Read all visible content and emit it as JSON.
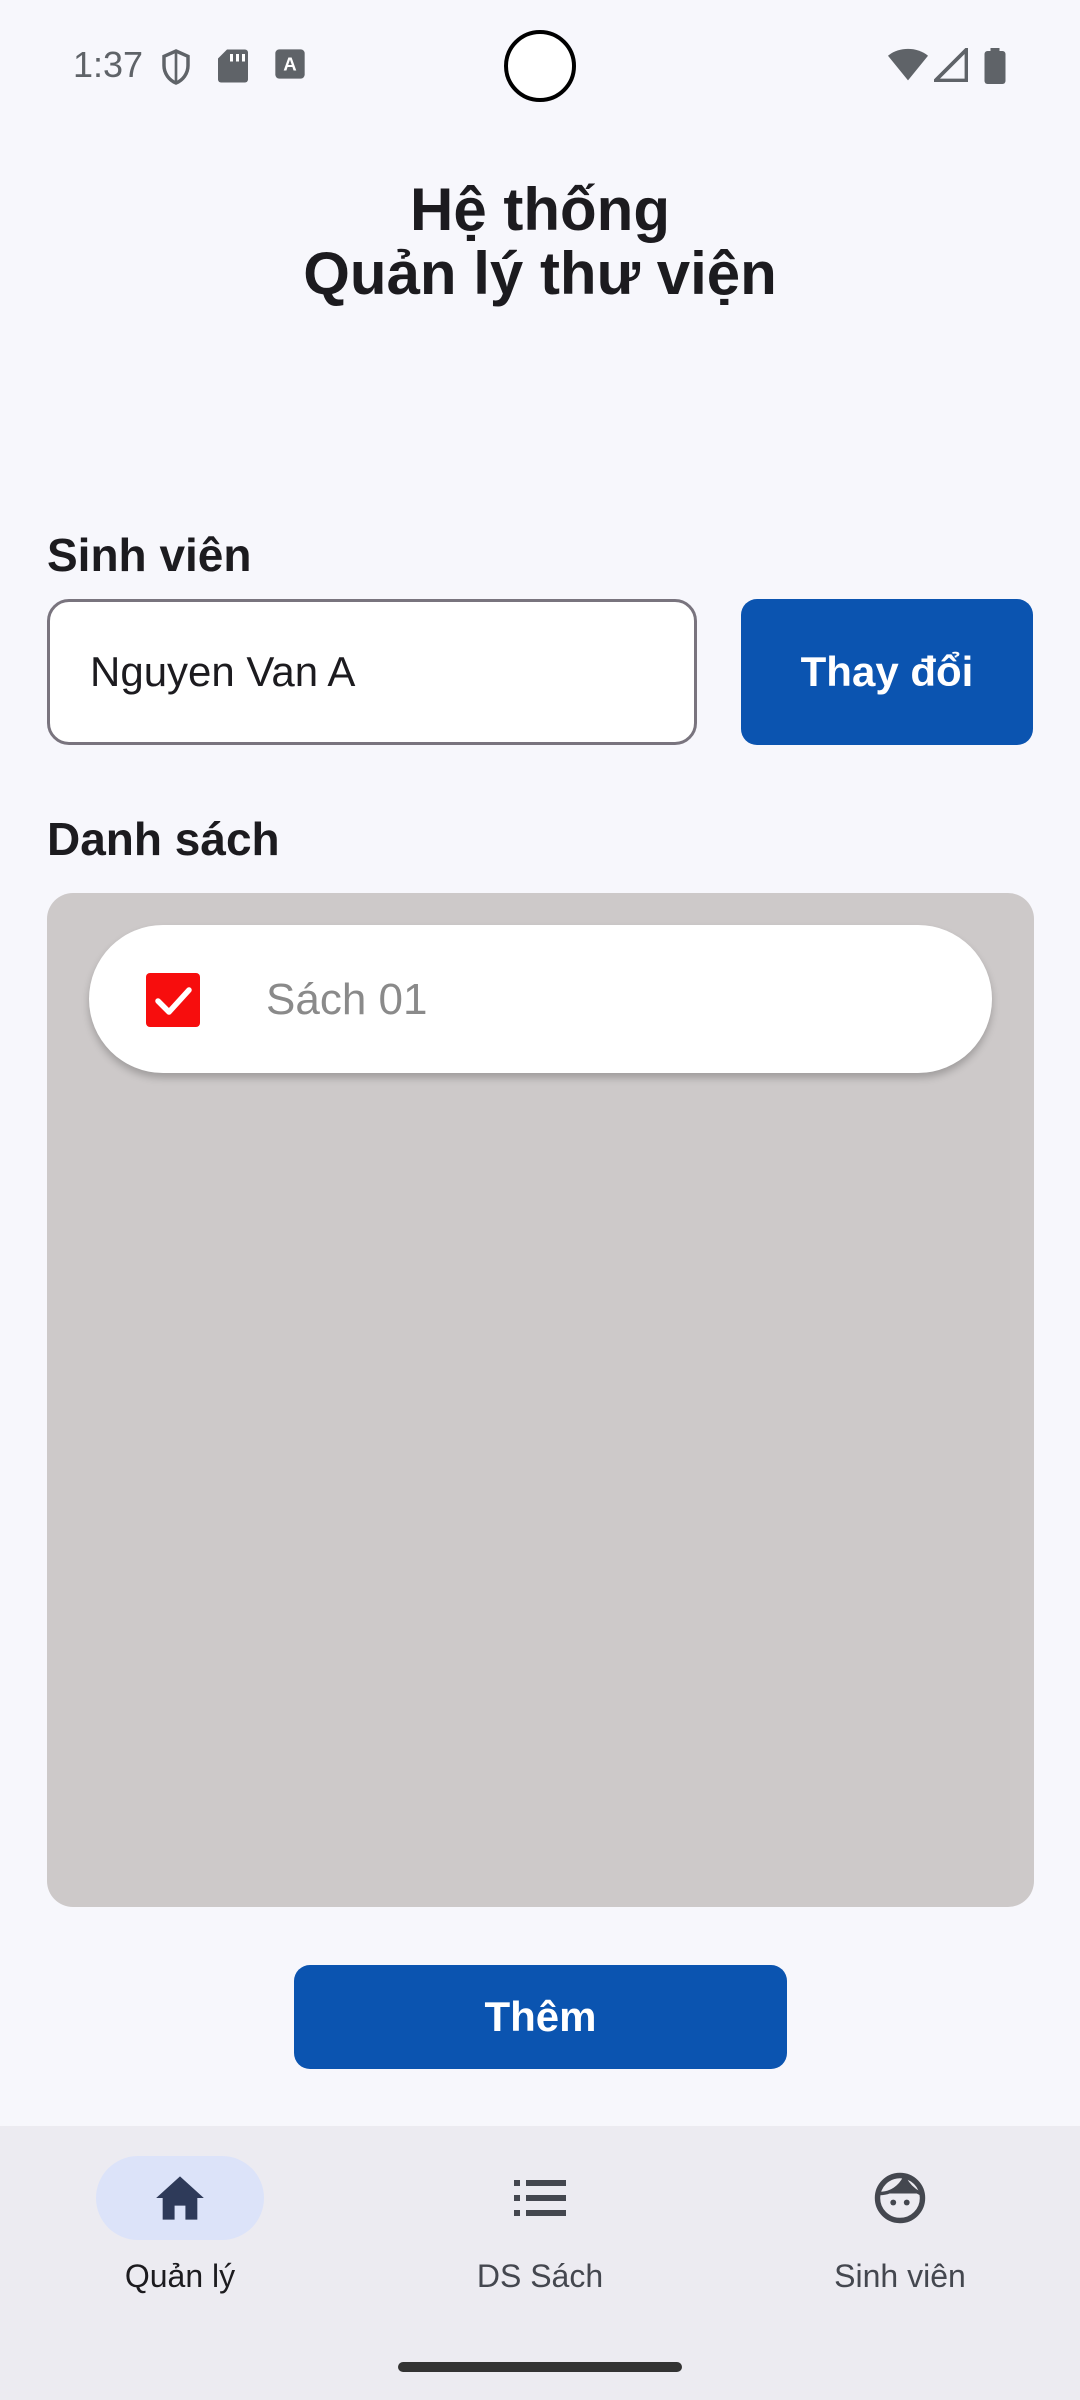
{
  "status_bar": {
    "time": "1:37",
    "left_icons": [
      "shield-icon",
      "sd-card-icon",
      "font-icon"
    ],
    "right_icons": [
      "wifi-icon",
      "signal-icon",
      "battery-icon"
    ]
  },
  "header": {
    "title_line1": "Hệ thống",
    "title_line2": "Quản lý thư viện"
  },
  "student": {
    "label": "Sinh viên",
    "input_value": "Nguyen Van A",
    "change_button": "Thay đổi"
  },
  "list": {
    "label": "Danh sách",
    "items": [
      {
        "label": "Sách 01",
        "checked": true
      }
    ]
  },
  "add_button": "Thêm",
  "bottom_nav": {
    "items": [
      {
        "label": "Quản lý",
        "icon": "home-icon",
        "active": true
      },
      {
        "label": "DS Sách",
        "icon": "list-icon",
        "active": false
      },
      {
        "label": "Sinh viên",
        "icon": "face-icon",
        "active": false
      }
    ]
  },
  "colors": {
    "primary": "#0b54b0",
    "checkbox": "#f70d0d",
    "list_background": "#cdc9c9",
    "nav_active_pill": "#dce3f9"
  }
}
